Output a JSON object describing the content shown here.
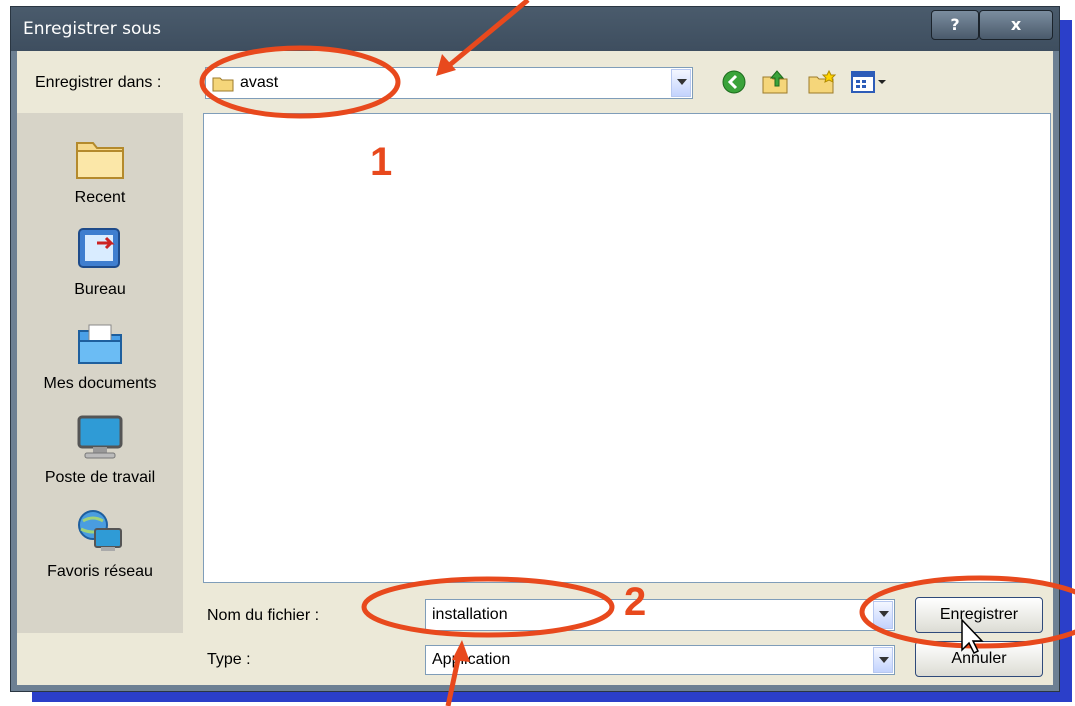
{
  "window": {
    "title": "Enregistrer sous",
    "help_label": "?",
    "close_label": "x"
  },
  "location": {
    "label": "Enregistrer dans :",
    "current_folder": "avast"
  },
  "places": [
    {
      "label": "Recent",
      "icon": "recent-folder-icon"
    },
    {
      "label": "Bureau",
      "icon": "desktop-icon"
    },
    {
      "label": "Mes documents",
      "icon": "my-documents-icon"
    },
    {
      "label": "Poste de travail",
      "icon": "my-computer-icon"
    },
    {
      "label": "Favoris réseau",
      "icon": "network-places-icon"
    }
  ],
  "filename": {
    "label": "Nom du fichier :",
    "value": "installation"
  },
  "filetype": {
    "label": "Type :",
    "value": "Application"
  },
  "buttons": {
    "save": "Enregistrer",
    "cancel": "Annuler"
  },
  "annotations": {
    "one": "1",
    "two": "2",
    "color": "#e8491d"
  }
}
